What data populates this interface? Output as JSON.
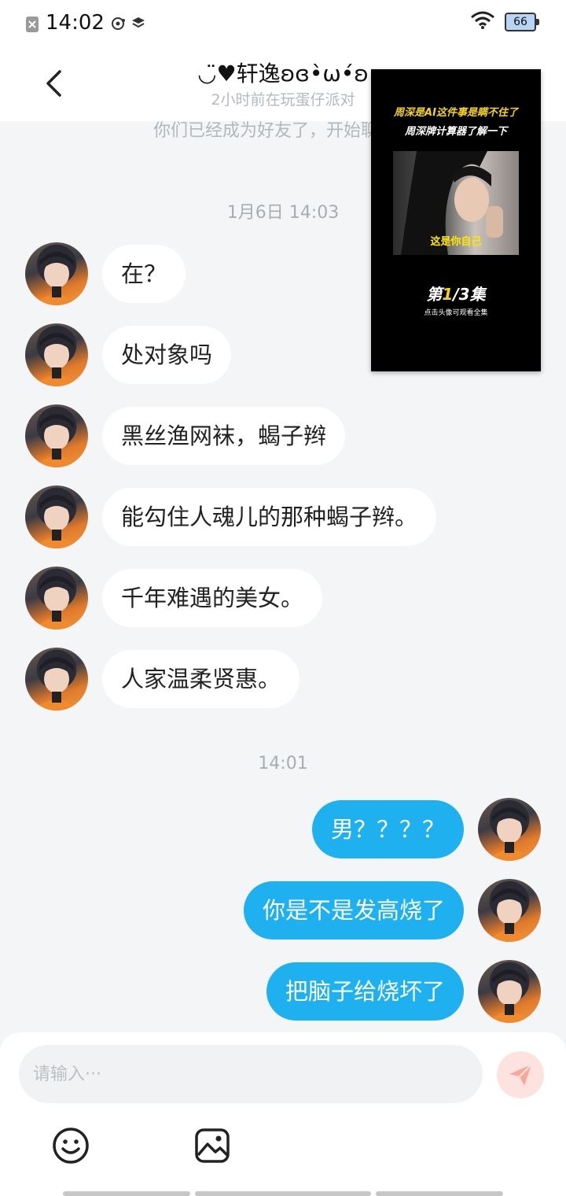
{
  "status_bar": {
    "time": "14:02",
    "battery": "66"
  },
  "header": {
    "title": "◡̈♥轩逸ʚɞ•̀ω•́ʚ",
    "subtitle": "2小时前在玩蛋仔派对"
  },
  "chat": {
    "system_note": "你们已经成为好友了，开始聊天吧",
    "timestamp_1": "1月6日 14:03",
    "incoming": [
      {
        "text": "在？"
      },
      {
        "text": "处对象吗"
      },
      {
        "text": "黑丝渔网袜，蝎子辫"
      },
      {
        "text": "能勾住人魂儿的那种蝎子辫。"
      },
      {
        "text": "千年难遇的美女。"
      },
      {
        "text": "人家温柔贤惠。"
      }
    ],
    "timestamp_2": "14:01",
    "outgoing": [
      {
        "text": "男？？？？"
      },
      {
        "text": "你是不是发高烧了"
      },
      {
        "text": "把脑子给烧坏了"
      }
    ]
  },
  "video_overlay": {
    "line1": "周深是AI这件事是瞒不住了",
    "line2": "周深牌计算器了解一下",
    "caption": "这是你自己",
    "episode_prefix": "第",
    "episode_current": "1",
    "episode_suffix": "/3集",
    "small_text": "点击头像可观看全集"
  },
  "input": {
    "placeholder": "请输入···"
  },
  "colors": {
    "outgoing_bubble": "#1fb0f0",
    "incoming_bubble": "#ffffff",
    "background": "#f3f5f7",
    "send_button": "#fde3df"
  },
  "icons": {
    "back": "chevron-left-icon",
    "send": "paper-plane-icon",
    "emoji": "smiley-icon",
    "image": "image-icon"
  }
}
